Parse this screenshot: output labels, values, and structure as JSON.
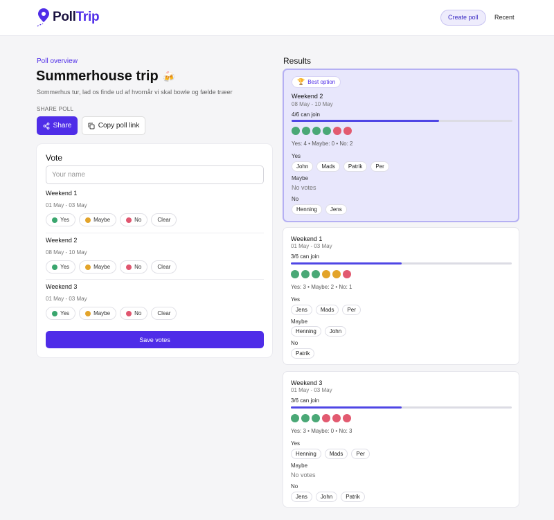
{
  "header": {
    "logo_text_a": "Poll",
    "logo_text_b": "Trip",
    "create_label": "Create poll",
    "recent_label": "Recent"
  },
  "poll": {
    "breadcrumb": "Poll overview",
    "title": "Summerhouse trip",
    "title_emoji": "🍻",
    "description": "Sommerhus tur, lad os finde ud af hvornår vi skal bowle og fælde træer",
    "share_heading": "SHARE POLL",
    "share_label": "Share",
    "copy_label": "Copy poll link"
  },
  "vote": {
    "title": "Vote",
    "name_placeholder": "Your name",
    "yes_label": "Yes",
    "maybe_label": "Maybe",
    "no_label": "No",
    "clear_label": "Clear",
    "save_label": "Save votes",
    "options": [
      {
        "name": "Weekend 1",
        "date": "01 May - 03 May"
      },
      {
        "name": "Weekend 2",
        "date": "08 May - 10 May"
      },
      {
        "name": "Weekend 3",
        "date": "01 May - 03 May"
      }
    ]
  },
  "results": {
    "title": "Results",
    "best_label": "Best option",
    "yes_heading": "Yes",
    "maybe_heading": "Maybe",
    "no_heading": "No",
    "no_votes": "No votes",
    "cards": [
      {
        "name": "Weekend 2",
        "date": "08 May - 10 May",
        "join": "4/6 can join",
        "progress": 0.667,
        "dots": [
          "yes",
          "yes",
          "yes",
          "yes",
          "no",
          "no"
        ],
        "summary": "Yes: 4 • Maybe: 0 • No: 2",
        "yes": [
          "John",
          "Mads",
          "Patrik",
          "Per"
        ],
        "maybe": [],
        "no": [
          "Henning",
          "Jens"
        ]
      },
      {
        "name": "Weekend 1",
        "date": "01 May - 03 May",
        "join": "3/6 can join",
        "progress": 0.5,
        "dots": [
          "yes",
          "yes",
          "yes",
          "maybe",
          "maybe",
          "no"
        ],
        "summary": "Yes: 3 • Maybe: 2 • No: 1",
        "yes": [
          "Jens",
          "Mads",
          "Per"
        ],
        "maybe": [
          "Henning",
          "John"
        ],
        "no": [
          "Patrik"
        ]
      },
      {
        "name": "Weekend 3",
        "date": "01 May - 03 May",
        "join": "3/6 can join",
        "progress": 0.5,
        "dots": [
          "yes",
          "yes",
          "yes",
          "no",
          "no",
          "no"
        ],
        "summary": "Yes: 3 • Maybe: 0 • No: 3",
        "yes": [
          "Henning",
          "Mads",
          "Per"
        ],
        "maybe": [],
        "no": [
          "Jens",
          "John",
          "Patrik"
        ]
      }
    ]
  },
  "colors": {
    "accent": "#4f2de8",
    "yes": "#4aa876",
    "maybe": "#e3a42a",
    "no": "#e25a70"
  }
}
